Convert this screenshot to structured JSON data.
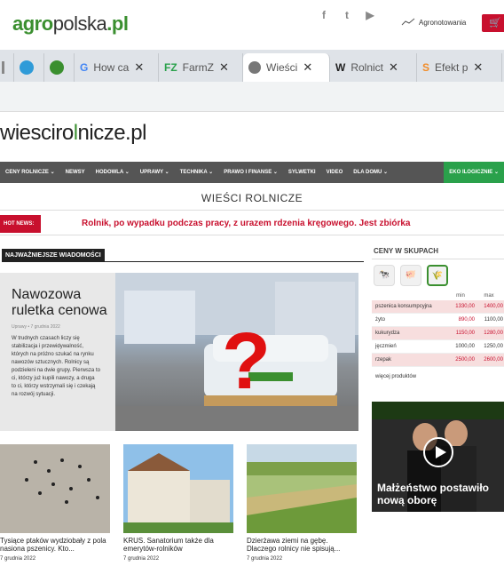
{
  "brand": {
    "agro": "agro",
    "polska": "polska",
    "tld": ".pl"
  },
  "header": {
    "notowania": "Agronotowania"
  },
  "tabs": [
    {
      "label": "How ca"
    },
    {
      "label": "FarmZ"
    },
    {
      "label": "Wieści"
    },
    {
      "label": "Rolnict"
    },
    {
      "label": "Efekt p"
    }
  ],
  "site": {
    "a": "wiesciro",
    "b": "l",
    "c": "nicze.pl"
  },
  "nav": [
    "CENY ROLNICZE",
    "NEWSY",
    "HODOWLA",
    "UPRAWY",
    "TECHNIKA",
    "PRAWO I FINANSE",
    "SYLWETKI",
    "VIDEO",
    "DLA DOMU",
    "EKO ILOGICZNIE"
  ],
  "section_title": "WIEŚCI ROLNICZE",
  "hot": {
    "label": "HOT NEWS:",
    "text": "Rolnik, po wypadku podczas pracy, z urazem rdzenia kręgowego. Jest zbiórka"
  },
  "news_header": "NAJWAŻNIEJSZE WIADOMOŚCI",
  "lead": {
    "title": "Nawozowa ruletka cenowa",
    "meta": "Uprawy  •  7 grudnia 2022",
    "body": "W trudnych czasach liczy się stabilizacja i przewidywalność, których na próżno szukać na rynku nawozów sztucznych. Rolnicy są podzieleni na dwie grupy. Pierwsza to ci, którzy już kupili nawozy, a druga to ci, którzy wstrzymali się i czekają na rozwój sytuacji."
  },
  "thumbs": [
    {
      "title": "Tysiące ptaków wydziobały z pola nasiona pszenicy. Kto...",
      "date": "7 grudnia 2022"
    },
    {
      "title": "KRUS. Sanatorium także dla emerytów-rolników",
      "date": "7 grudnia 2022"
    },
    {
      "title": "Dzierżawa ziemi na gębę. Dlaczego rolnicy nie spisują...",
      "date": "7 grudnia 2022"
    }
  ],
  "prices": {
    "title": "CENY W SKUPACH",
    "head_min": "min",
    "head_max": "max",
    "rows": [
      {
        "name": "pszenica konsumpcyjna",
        "min": "1330,00",
        "max": "1400,00"
      },
      {
        "name": "żyto",
        "min": "890,00",
        "max": "1100,00"
      },
      {
        "name": "kukurydza",
        "min": "1150,00",
        "max": "1280,00"
      },
      {
        "name": "jęczmień",
        "min": "1000,00",
        "max": "1250,00"
      },
      {
        "name": "rzepak",
        "min": "2500,00",
        "max": "2600,00"
      }
    ],
    "more": "więcej produktów"
  },
  "video": {
    "caption": "Małżeństwo postawiło nową oborę"
  }
}
